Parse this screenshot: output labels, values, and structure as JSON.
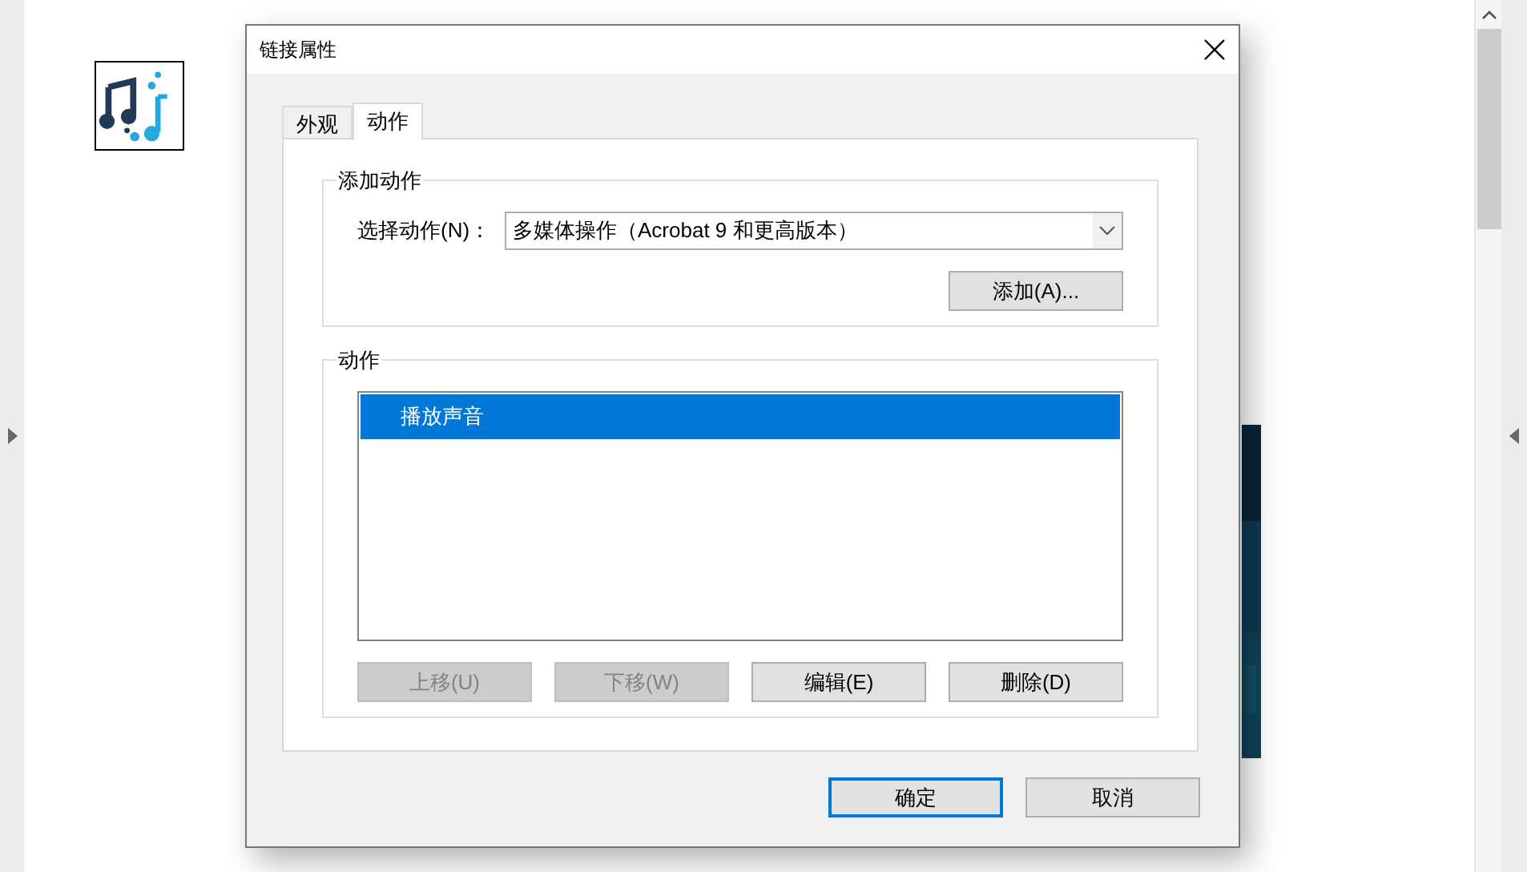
{
  "window": {
    "title": "链接属性"
  },
  "tabs": [
    {
      "label": "外观",
      "selected": false
    },
    {
      "label": "动作",
      "selected": true
    }
  ],
  "add_action": {
    "legend": "添加动作",
    "select_label": "选择动作(N)：",
    "select_value": "多媒体操作（Acrobat 9 和更高版本）",
    "add_button": "添加(A)..."
  },
  "actions": {
    "legend": "动作",
    "items": [
      {
        "label": "播放声音",
        "selected": true
      }
    ],
    "buttons": [
      {
        "label": "上移(U)",
        "disabled": true
      },
      {
        "label": "下移(W)",
        "disabled": true
      },
      {
        "label": "编辑(E)",
        "disabled": false
      },
      {
        "label": "删除(D)",
        "disabled": false
      }
    ]
  },
  "footer_buttons": [
    {
      "label": "确定",
      "default": true
    },
    {
      "label": "取消",
      "default": false
    }
  ]
}
